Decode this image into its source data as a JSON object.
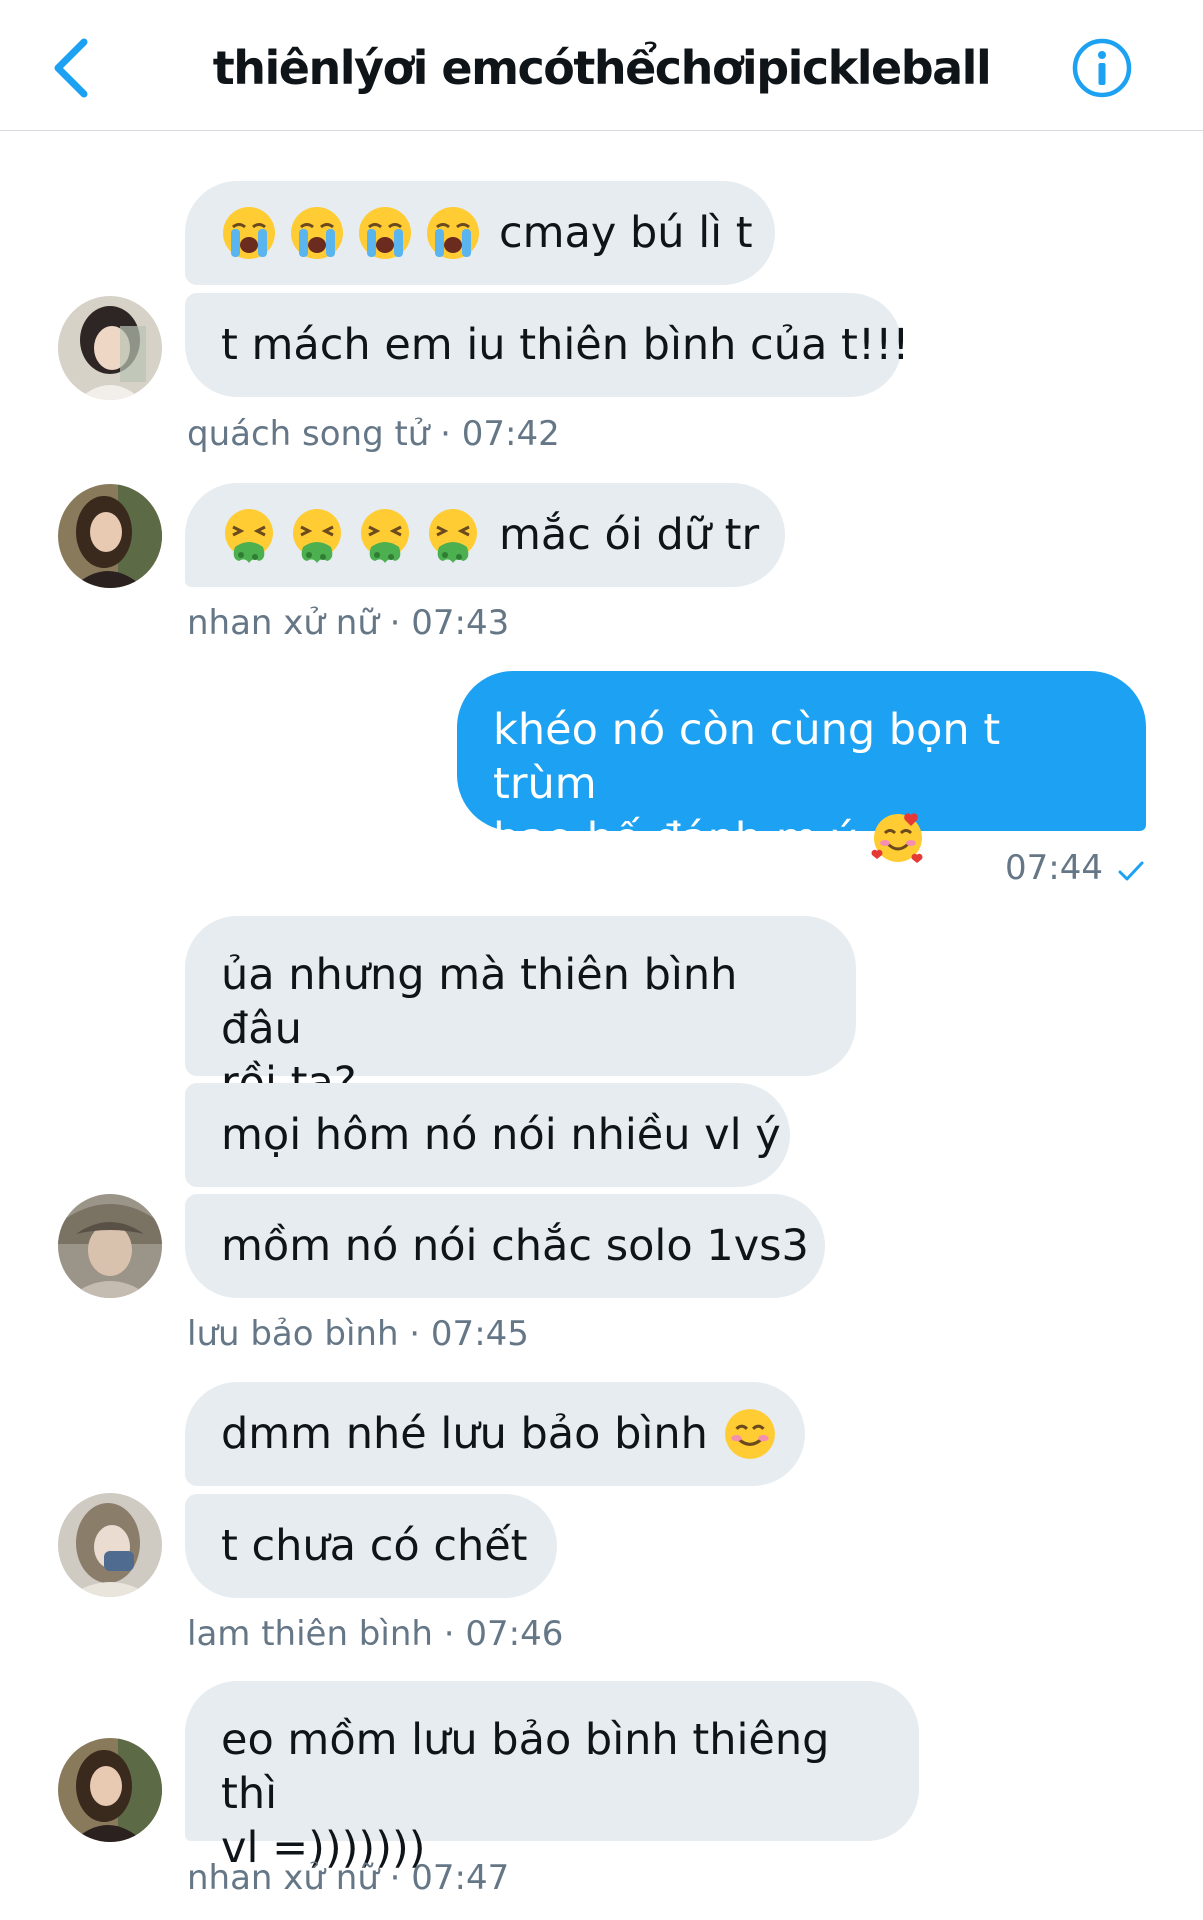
{
  "header": {
    "title": "thiênlýơi emcóthểchơipickleball",
    "back_icon": "chevron-left-icon",
    "info_icon": "info-icon",
    "accent_color": "#1da1f2"
  },
  "messages": [
    {
      "sender": "quách song tử",
      "time": "07:42",
      "meta": "quách song tử · 07:42",
      "bubbles": [
        {
          "emoji": "loudly-crying-face",
          "emoji_count": 4,
          "text": "cmay bú lì t"
        },
        {
          "text": "t mách em iu thiên bình của t!!!"
        }
      ]
    },
    {
      "sender": "nhan xử nữ",
      "time": "07:43",
      "meta": "nhan xử nữ · 07:43",
      "bubbles": [
        {
          "emoji": "face-vomiting",
          "emoji_count": 4,
          "text": "mắc ói dữ tr"
        }
      ]
    },
    {
      "sender": "me",
      "time": "07:44",
      "meta": "07:44",
      "status": "sent-check-icon",
      "bubbles": [
        {
          "line1": "khéo nó còn cùng bọn t trùm",
          "line2": "bao bố đánh m ý",
          "emoji": "smiling-face-with-hearts"
        }
      ]
    },
    {
      "sender": "lưu bảo bình",
      "time": "07:45",
      "meta": "lưu bảo bình · 07:45",
      "bubbles": [
        {
          "line1": "ủa nhưng mà thiên bình đâu",
          "line2": "rồi ta?"
        },
        {
          "text": "mọi hôm nó nói nhiều vl ý"
        },
        {
          "text": "mồm nó nói chắc solo 1vs3"
        }
      ]
    },
    {
      "sender": "lam thiên bình",
      "time": "07:46",
      "meta": "lam thiên bình · 07:46",
      "bubbles": [
        {
          "text": "dmm nhé lưu bảo bình",
          "emoji": "smiling-face-with-smiling-eyes"
        },
        {
          "text": "t chưa có chết"
        }
      ]
    },
    {
      "sender": "nhan xử nữ",
      "time": "07:47",
      "meta": "nhan xử nữ · 07:47",
      "bubbles": [
        {
          "line1": "eo mồm lưu bảo bình thiêng thì",
          "line2": "vl =)))))))"
        }
      ]
    }
  ]
}
